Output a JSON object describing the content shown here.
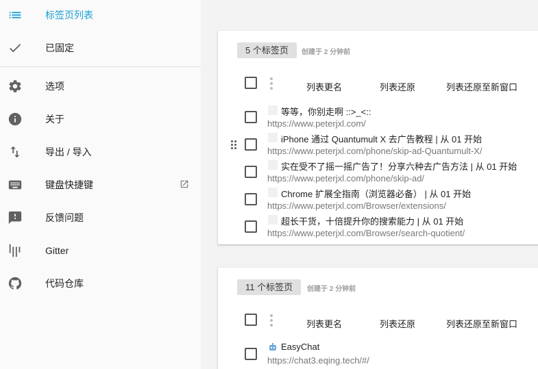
{
  "sidebar": {
    "items": [
      {
        "label": "标签页列表",
        "icon": "list-icon"
      },
      {
        "label": "已固定",
        "icon": "check-icon"
      },
      {
        "label": "选项",
        "icon": "gear-icon"
      },
      {
        "label": "关于",
        "icon": "info-icon"
      },
      {
        "label": "导出 / 导入",
        "icon": "swap-vertical-icon"
      },
      {
        "label": "键盘快捷键",
        "icon": "keyboard-icon",
        "external_icon": "open-in-new-icon"
      },
      {
        "label": "反馈问题",
        "icon": "feedback-icon"
      },
      {
        "label": "Gitter",
        "icon": "gitter-icon"
      },
      {
        "label": "代码仓库",
        "icon": "github-icon"
      }
    ],
    "accent_color": "#1a9fd6"
  },
  "lists": [
    {
      "count_label": "5 个标签页",
      "created": "创建于 2 分钟前",
      "toolbar": {
        "rename": "列表更名",
        "restore": "列表还原",
        "restore_new_window": "列表还原至新窗口"
      },
      "tabs": [
        {
          "title": "等等，你别走啊 ::>_<::",
          "url": "https://www.peterjxl.com/"
        },
        {
          "title": "iPhone 通过 Quantumult X 去广告教程 | 从 01 开始",
          "url": "https://www.peterjxl.com/phone/skip-ad-Quantumult-X/"
        },
        {
          "title": "实在受不了摇一摇广告了！分享六种去广告方法 | 从 01 开始",
          "url": "https://www.peterjxl.com/phone/skip-ad/"
        },
        {
          "title": "Chrome 扩展全指南（浏览器必备） | 从 01 开始",
          "url": "https://www.peterjxl.com/Browser/extensions/"
        },
        {
          "title": "超长干货，十倍提升你的搜索能力 | 从 01 开始",
          "url": "https://www.peterjxl.com/Browser/search-quotient/"
        }
      ]
    },
    {
      "count_label": "11 个标签页",
      "created": "创建于 2 分钟前",
      "toolbar": {
        "rename": "列表更名",
        "restore": "列表还原",
        "restore_new_window": "列表还原至新窗口"
      },
      "tabs": [
        {
          "title": "EasyChat",
          "url": "https://chat3.eqing.tech/#/"
        }
      ]
    }
  ]
}
